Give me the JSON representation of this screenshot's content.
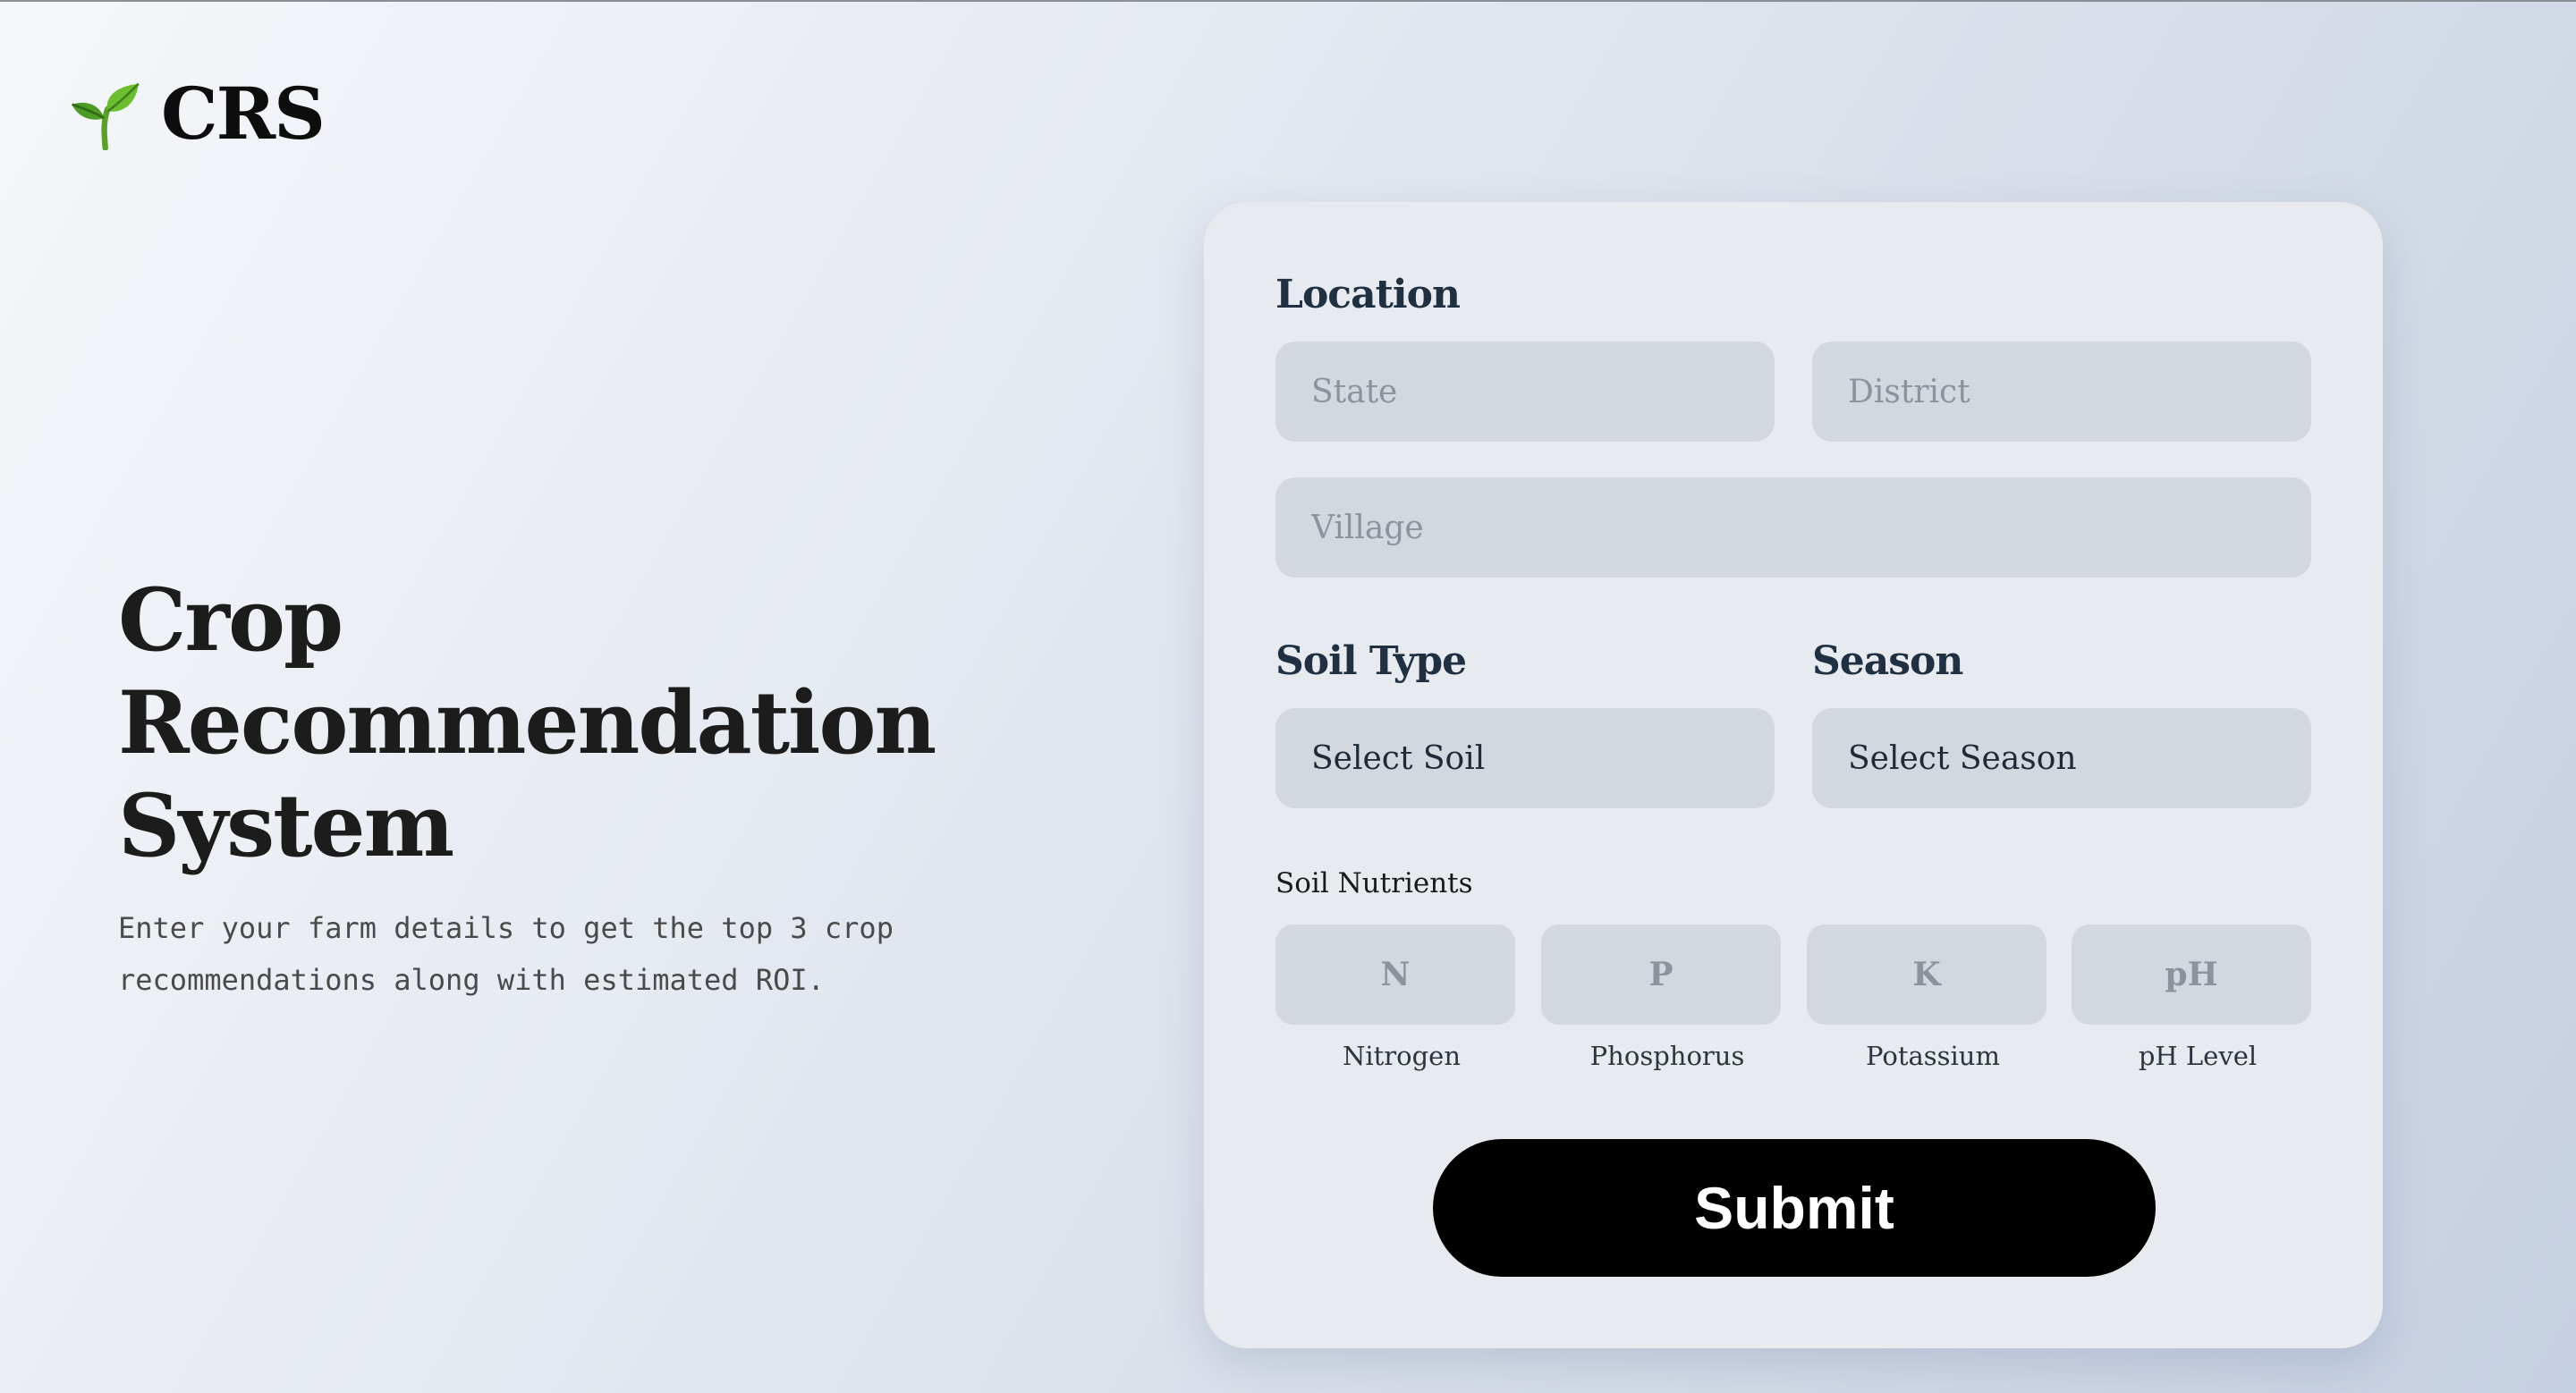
{
  "brand": {
    "icon": "seedling-icon",
    "name": "CRS"
  },
  "hero": {
    "title_lines": [
      "Crop",
      "Recommendation",
      "System"
    ],
    "description": "Enter your farm details to get the top 3 crop recommendations along with estimated ROI."
  },
  "form": {
    "location_label": "Location",
    "state_placeholder": "State",
    "district_placeholder": "District",
    "village_placeholder": "Village",
    "soil_type_label": "Soil Type",
    "soil_select_value": "Select Soil",
    "season_label": "Season",
    "season_select_value": "Select Season",
    "nutrients_label": "Soil Nutrients",
    "nutrients": [
      {
        "symbol": "N",
        "caption": "Nitrogen"
      },
      {
        "symbol": "P",
        "caption": "Phosphorus"
      },
      {
        "symbol": "K",
        "caption": "Potassium"
      },
      {
        "symbol": "pH",
        "caption": "pH Level"
      }
    ],
    "submit_label": "Submit"
  },
  "colors": {
    "accent": "#000000",
    "card_background": "#e7eaef",
    "field_background": "#d3d8df",
    "label_text": "#1f3042",
    "seedling_green": "#5aa12a"
  }
}
